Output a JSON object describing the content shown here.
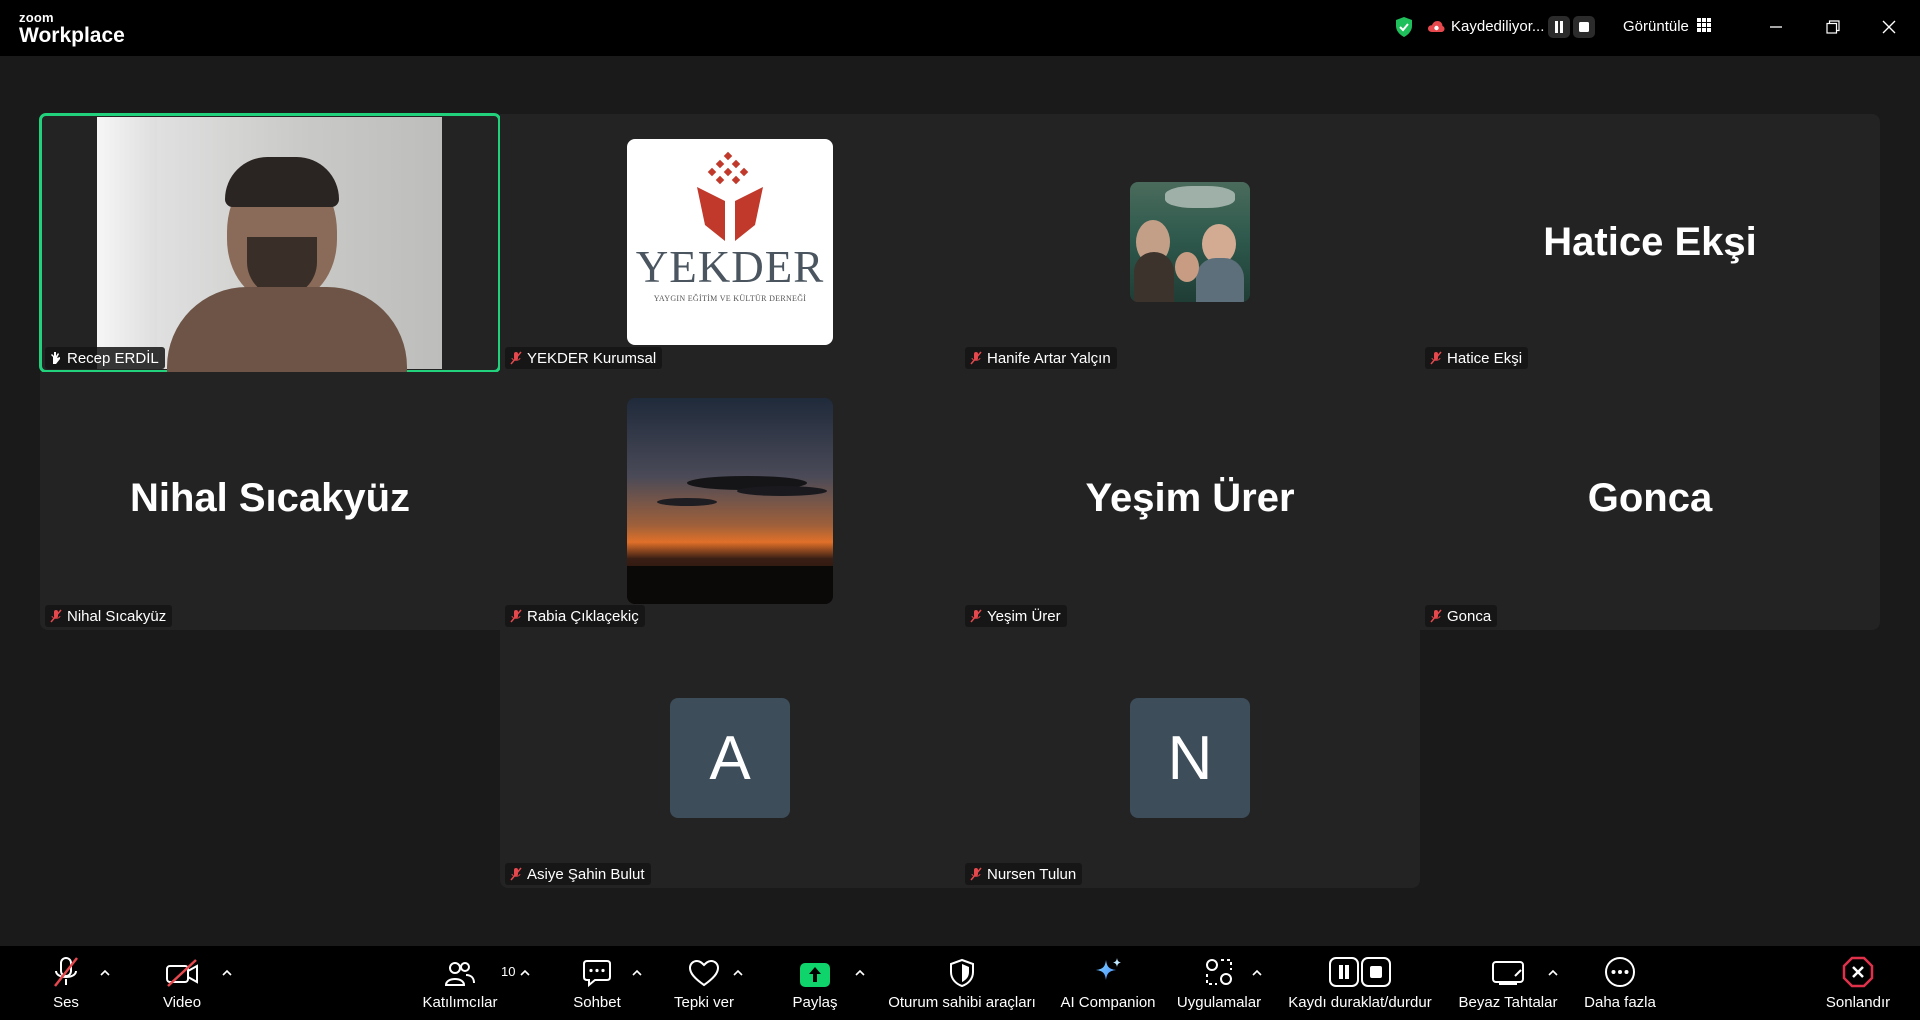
{
  "app": {
    "brand_small": "zoom",
    "brand_big": "Workplace"
  },
  "titlebar": {
    "recording_status": "Kaydediliyor...",
    "view_label": "Görüntüle",
    "icons": [
      "shield-check-icon",
      "cloud-record-icon",
      "pause-icon",
      "stop-icon",
      "grid-icon",
      "minimize-icon",
      "restore-icon",
      "close-icon"
    ]
  },
  "participants": [
    {
      "name": "Recep ERDİL",
      "type": "video",
      "active": true,
      "muted": false
    },
    {
      "name": "YEKDER Kurumsal",
      "type": "logo",
      "muted": true,
      "logo_word": "YEKDER",
      "logo_sub": "YAYGIN EĞİTİM VE KÜLTÜR DERNEĞİ"
    },
    {
      "name": "Hanife Artar Yalçın",
      "type": "photo",
      "muted": true
    },
    {
      "name": "Hatice Ekşi",
      "type": "name",
      "display": "Hatice Ekşi",
      "muted": true
    },
    {
      "name": "Nihal Sıcakyüz",
      "type": "name",
      "display": "Nihal Sıcakyüz",
      "muted": true
    },
    {
      "name": "Rabia Çıklaçekiç",
      "type": "photo",
      "muted": true
    },
    {
      "name": "Yeşim Ürer",
      "type": "name",
      "display": "Yeşim Ürer",
      "muted": true
    },
    {
      "name": "Gonca",
      "type": "name",
      "display": "Gonca",
      "muted": true
    },
    {
      "name": "Asiye Şahin Bulut",
      "type": "initial",
      "initial": "A",
      "muted": true
    },
    {
      "name": "Nursen Tulun",
      "type": "initial",
      "initial": "N",
      "muted": true
    }
  ],
  "toolbar": {
    "audio": "Ses",
    "video": "Video",
    "participants": "Katılımcılar",
    "participant_count": "10",
    "chat": "Sohbet",
    "react": "Tepki ver",
    "share": "Paylaş",
    "host_tools": "Oturum sahibi araçları",
    "ai": "AI Companion",
    "apps": "Uygulamalar",
    "record": "Kaydı duraklat/durdur",
    "whiteboards": "Beyaz Tahtalar",
    "more": "Daha fazla",
    "end": "Sonlandır"
  },
  "colors": {
    "accent_green": "#22d17c",
    "share_green": "#0fd46b",
    "muted_red": "#e5484d",
    "end_red": "#e0314b",
    "tile_bg": "#232323",
    "avatar_bg": "#3d4d5a"
  }
}
